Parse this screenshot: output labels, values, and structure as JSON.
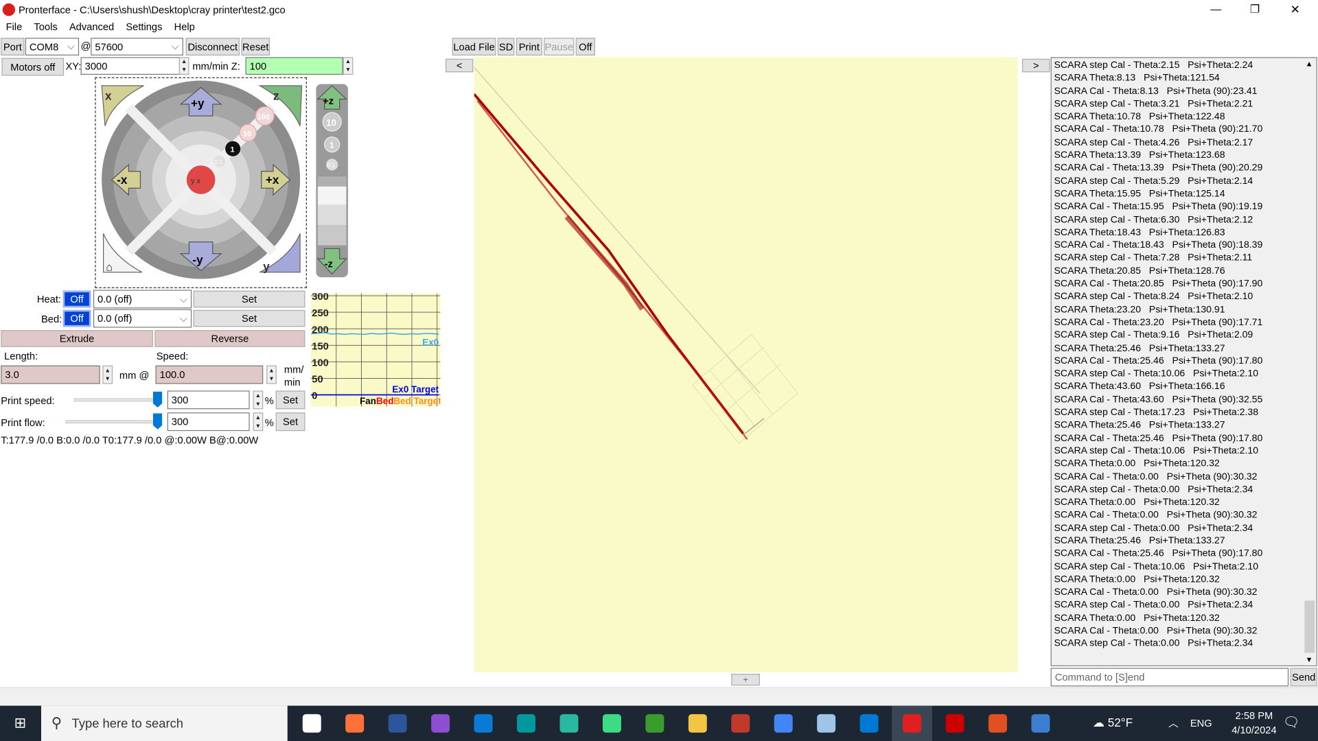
{
  "window": {
    "title": "Pronterface - C:\\Users\\shush\\Desktop\\cray printer\\test2.gco",
    "minimize": "—",
    "restore": "❐",
    "close": "✕"
  },
  "menu": [
    "File",
    "Tools",
    "Advanced",
    "Settings",
    "Help"
  ],
  "toolbar": {
    "port_label": "Port",
    "port_value": "COM8",
    "at": "@",
    "baud_value": "57600",
    "disconnect": "Disconnect",
    "reset": "Reset",
    "load_file": "Load File",
    "sd": "SD",
    "print": "Print",
    "pause": "Pause",
    "off": "Off"
  },
  "motion": {
    "motors_off": "Motors off",
    "xy_label": "XY:",
    "xy_value": "3000",
    "z_label": "mm/min Z:",
    "z_value": "100"
  },
  "jog": {
    "home_x": "x",
    "plus_y": "+y",
    "home_z": "z",
    "minus_x": "-x",
    "plus_x": "+x",
    "minus_y": "-y",
    "home_y": "y",
    "steps": [
      "100",
      "10",
      "1",
      "0.1"
    ],
    "center_label": "y x",
    "z_plus": "+z",
    "z_minus": "-z",
    "z_steps": [
      "10",
      "1",
      "0.1"
    ]
  },
  "temps": {
    "heat_label": "Heat:",
    "heat_toggle": "Off",
    "heat_value": "0.0 (off)",
    "bed_label": "Bed:",
    "bed_toggle": "Off",
    "bed_value": "0.0 (off)",
    "set": "Set"
  },
  "extrude": {
    "extrude": "Extrude",
    "reverse": "Reverse",
    "length_label": "Length:",
    "speed_label": "Speed:",
    "length_value": "3.0",
    "mm_at": "mm @",
    "speed_value": "100.0",
    "unit1": "mm/",
    "unit2": "min"
  },
  "print_speed": {
    "label": "Print speed:",
    "value": "300",
    "pct": "%",
    "set": "Set",
    "slider_fraction": 1.0
  },
  "print_flow": {
    "label": "Print flow:",
    "value": "300",
    "pct": "%",
    "set": "Set",
    "slider_fraction": 1.0
  },
  "status": "T:177.9 /0.0 B:0.0 /0.0 T0:177.9 /0.0 @:0.00W B@:0.00W",
  "chart_data": {
    "type": "line",
    "ylim": [
      0,
      300
    ],
    "yticks": [
      "300",
      "250",
      "200",
      "150",
      "100",
      "50",
      "0"
    ],
    "grid": true,
    "series": [
      {
        "name": "Ex0",
        "color": "#3aa7e8",
        "values": [
          185,
          186,
          188,
          184,
          185,
          183,
          185,
          184,
          183,
          186,
          184,
          185,
          187,
          184,
          183,
          185,
          184,
          186,
          185,
          184
        ]
      },
      {
        "name": "Ex0 Target",
        "color": "#0000e0",
        "values": [
          0,
          0
        ]
      }
    ],
    "legend": [
      {
        "name": "Fan",
        "color": "#000000"
      },
      {
        "name": "Bed",
        "color": "#ff0000"
      },
      {
        "name": "Bed Target",
        "color": "#ff8c1a"
      }
    ]
  },
  "canvas": {
    "prev": "<",
    "next": ">",
    "plus": "+",
    "bg": "#fafac8",
    "path": "#b00000"
  },
  "log": [
    "SCARA step Cal - Theta:2.15   Psi+Theta:2.24",
    "SCARA Theta:8.13   Psi+Theta:121.54",
    "SCARA Cal - Theta:8.13   Psi+Theta (90):23.41",
    "SCARA step Cal - Theta:3.21   Psi+Theta:2.21",
    "SCARA Theta:10.78   Psi+Theta:122.48",
    "SCARA Cal - Theta:10.78   Psi+Theta (90):21.70",
    "SCARA step Cal - Theta:4.26   Psi+Theta:2.17",
    "SCARA Theta:13.39   Psi+Theta:123.68",
    "SCARA Cal - Theta:13.39   Psi+Theta (90):20.29",
    "SCARA step Cal - Theta:5.29   Psi+Theta:2.14",
    "SCARA Theta:15.95   Psi+Theta:125.14",
    "SCARA Cal - Theta:15.95   Psi+Theta (90):19.19",
    "SCARA step Cal - Theta:6.30   Psi+Theta:2.12",
    "SCARA Theta:18.43   Psi+Theta:126.83",
    "SCARA Cal - Theta:18.43   Psi+Theta (90):18.39",
    "SCARA step Cal - Theta:7.28   Psi+Theta:2.11",
    "SCARA Theta:20.85   Psi+Theta:128.76",
    "SCARA Cal - Theta:20.85   Psi+Theta (90):17.90",
    "SCARA step Cal - Theta:8.24   Psi+Theta:2.10",
    "SCARA Theta:23.20   Psi+Theta:130.91",
    "SCARA Cal - Theta:23.20   Psi+Theta (90):17.71",
    "SCARA step Cal - Theta:9.16   Psi+Theta:2.09",
    "SCARA Theta:25.46   Psi+Theta:133.27",
    "SCARA Cal - Theta:25.46   Psi+Theta (90):17.80",
    "SCARA step Cal - Theta:10.06   Psi+Theta:2.10",
    "SCARA Theta:43.60   Psi+Theta:166.16",
    "SCARA Cal - Theta:43.60   Psi+Theta (90):32.55",
    "SCARA step Cal - Theta:17.23   Psi+Theta:2.38",
    "SCARA Theta:25.46   Psi+Theta:133.27",
    "SCARA Cal - Theta:25.46   Psi+Theta (90):17.80",
    "SCARA step Cal - Theta:10.06   Psi+Theta:2.10",
    "SCARA Theta:0.00   Psi+Theta:120.32",
    "SCARA Cal - Theta:0.00   Psi+Theta (90):30.32",
    "SCARA step Cal - Theta:0.00   Psi+Theta:2.34",
    "SCARA Theta:0.00   Psi+Theta:120.32",
    "SCARA Cal - Theta:0.00   Psi+Theta (90):30.32",
    "SCARA step Cal - Theta:0.00   Psi+Theta:2.34",
    "SCARA Theta:25.46   Psi+Theta:133.27",
    "SCARA Cal - Theta:25.46   Psi+Theta (90):17.80",
    "SCARA step Cal - Theta:10.06   Psi+Theta:2.10",
    "SCARA Theta:0.00   Psi+Theta:120.32",
    "SCARA Cal - Theta:0.00   Psi+Theta (90):30.32",
    "SCARA step Cal - Theta:0.00   Psi+Theta:2.34",
    "SCARA Theta:0.00   Psi+Theta:120.32",
    "SCARA Cal - Theta:0.00   Psi+Theta (90):30.32",
    "SCARA step Cal - Theta:0.00   Psi+Theta:2.34"
  ],
  "command": {
    "placeholder": "Command to [S]end",
    "send": "Send"
  },
  "taskbar": {
    "search_placeholder": "Type here to search",
    "weather": "52°F",
    "lang": "ENG",
    "time": "2:58 PM",
    "date": "4/10/2024",
    "apps": [
      "panda",
      "firefox",
      "word",
      "visual-studio",
      "store",
      "arduino",
      "edge",
      "android",
      "turtle",
      "file-explorer",
      "winrar",
      "chrome",
      "notepad",
      "vscode",
      "pronterface",
      "filezilla",
      "recolor",
      "app"
    ]
  }
}
